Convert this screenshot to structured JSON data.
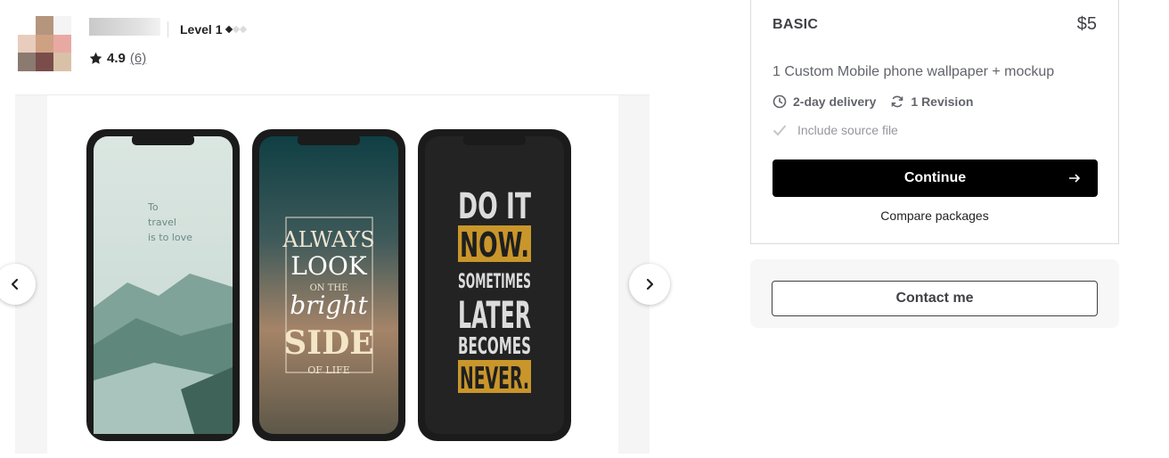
{
  "seller": {
    "level": "Level 1",
    "rating": "4.9",
    "review_count": "(6)"
  },
  "gallery": {
    "prev_icon": "chevron-left-icon",
    "next_icon": "chevron-right-icon",
    "phone1": {
      "lines": [
        "To",
        "travel",
        "is to love"
      ]
    },
    "phone2": {
      "lines": [
        "ALWAYS",
        "LOOK",
        "ON THE",
        "bright",
        "SIDE",
        "OF LIFE"
      ]
    },
    "phone3": {
      "lines": [
        "DO IT",
        "NOW.",
        "SOMETIMES",
        "LATER",
        "BECOMES",
        "NEVER."
      ]
    }
  },
  "package": {
    "name": "BASIC",
    "price": "$5",
    "description": "1 Custom Mobile phone wallpaper + mockup",
    "delivery": "2-day delivery",
    "revisions": "1 Revision",
    "feature": "Include source file",
    "continue_label": "Continue",
    "compare_label": "Compare packages"
  },
  "contact": {
    "label": "Contact me"
  },
  "colors": {
    "accent_gold": "#c9962b",
    "button_black": "#000000",
    "text_dark": "#404145"
  }
}
